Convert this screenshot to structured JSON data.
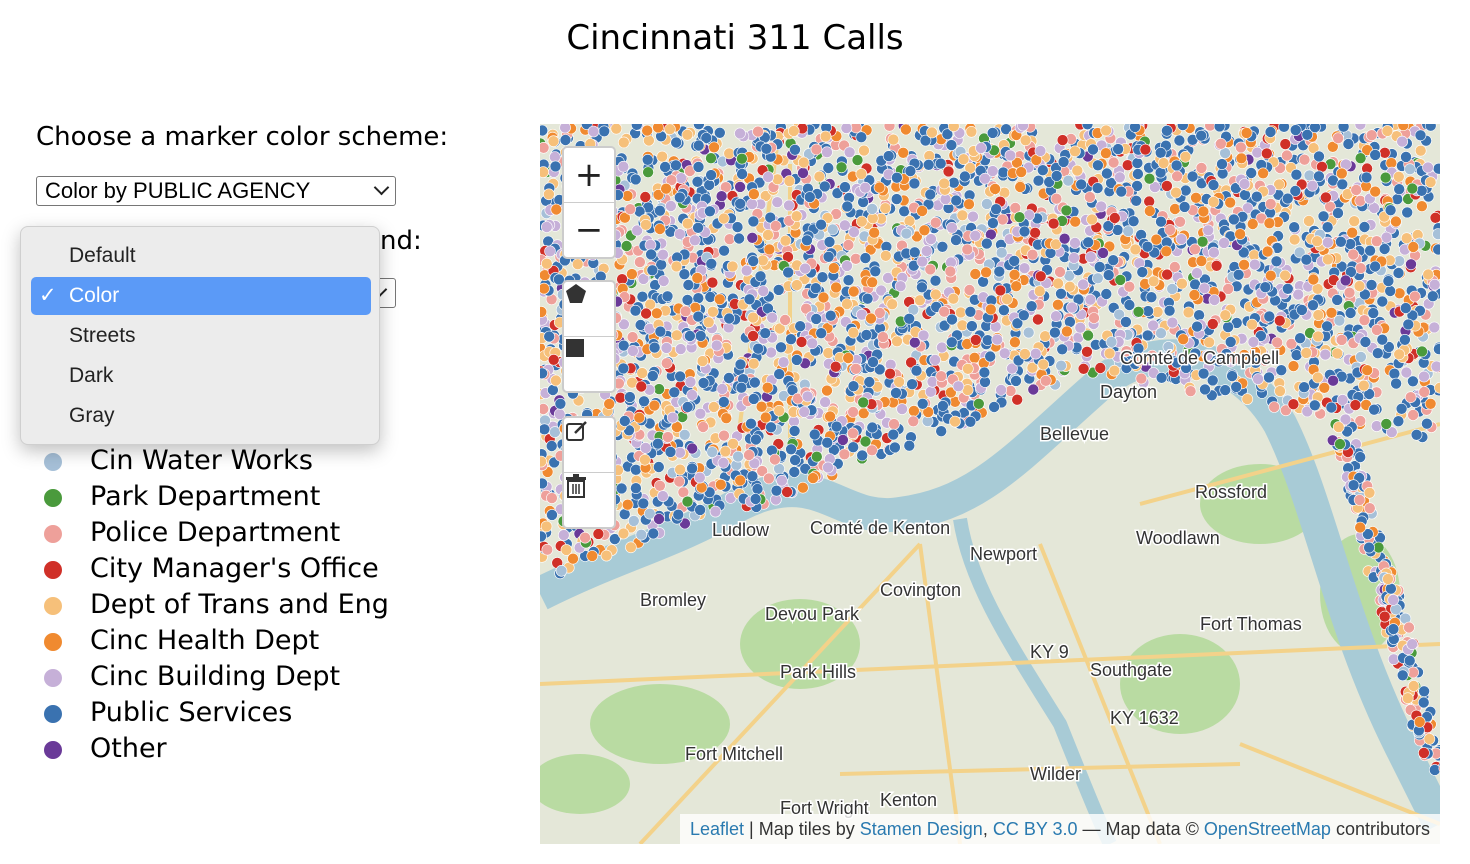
{
  "page_title": "Cincinnati 311 Calls",
  "color_scheme": {
    "prompt": "Choose a marker color scheme:",
    "selected": "Color by PUBLIC AGENCY"
  },
  "background": {
    "prompt_partial": "nd:",
    "options": [
      "Default",
      "Color",
      "Streets",
      "Dark",
      "Gray"
    ],
    "selected_index": 1
  },
  "legend": [
    {
      "label": "Cin Water Works",
      "color": "#a6c0d8"
    },
    {
      "label": "Park Department",
      "color": "#4a9a3c"
    },
    {
      "label": "Police Department",
      "color": "#eea09a"
    },
    {
      "label": "City Manager's Office",
      "color": "#d03028"
    },
    {
      "label": "Dept of Trans and Eng",
      "color": "#f6c07a"
    },
    {
      "label": "Cinc Health Dept",
      "color": "#f08a30"
    },
    {
      "label": "Cinc Building Dept",
      "color": "#c6b0d8"
    },
    {
      "label": "Public Services",
      "color": "#3a72b0"
    },
    {
      "label": "Other",
      "color": "#6a3a98"
    }
  ],
  "map": {
    "zoom_in": "+",
    "zoom_out": "−",
    "tools": [
      "draw-polygon-icon",
      "draw-rectangle-icon",
      "edit-layers-icon",
      "delete-layers-icon"
    ],
    "labels": [
      "Dayton",
      "Bellevue",
      "Ludlow",
      "Newport",
      "Woodlawn",
      "Bromley",
      "Covington",
      "Devou Park",
      "Fort Thomas",
      "Park Hills",
      "Southgate",
      "KY 9",
      "KY 1632",
      "Fort Mitchell",
      "Wilder",
      "Fort Wright",
      "Kenton",
      "Rossford",
      "Comté de Campbell",
      "Comté de Kenton"
    ],
    "attribution": {
      "leaflet": "Leaflet",
      "sep1": " | Map tiles by ",
      "stamen": "Stamen Design",
      "sep2": ", ",
      "license": "CC BY 3.0",
      "sep3": " — Map data © ",
      "osm": "OpenStreetMap",
      "suffix": " contributors"
    }
  }
}
